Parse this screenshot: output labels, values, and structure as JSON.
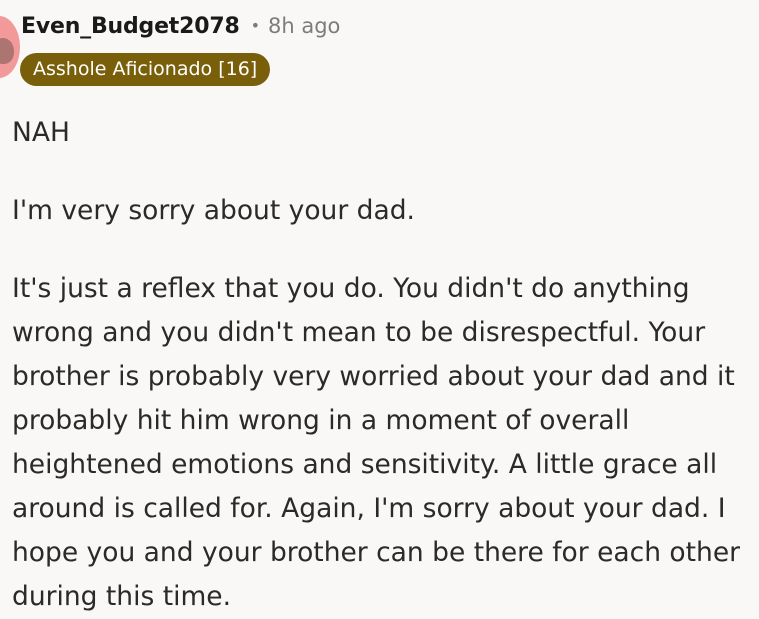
{
  "comment": {
    "username": "Even_Budget2078",
    "separator": "•",
    "timestamp": "8h ago",
    "flair": "Asshole Aficionado [16]",
    "paragraphs": [
      "NAH",
      "I'm very sorry about your dad.",
      "It's just a reflex that you do. You didn't do anything wrong and you didn't mean to be disrespectful. Your brother is probably very worried about your dad and it probably hit him wrong in a moment of overall heightened emotions and sensitivity. A little grace all around is called for. Again, I'm sorry about your dad. I hope you and your brother can be there for each other during this time."
    ]
  },
  "colors": {
    "background": "#f9f8f6",
    "flair_background": "#7a5f0a",
    "avatar": "#f29a9a"
  }
}
